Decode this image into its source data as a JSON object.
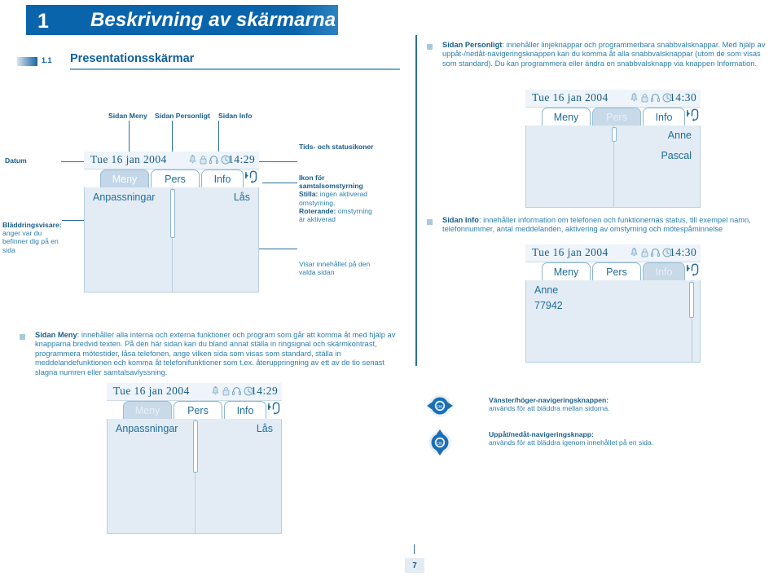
{
  "chapter": {
    "number": "1",
    "title": "Beskrivning av skärmarna"
  },
  "section": {
    "number": "1.1",
    "title": "Presentationsskärmar"
  },
  "paragraphs": {
    "personligt_lead": "Sidan Personligt",
    "personligt_body": ": innehåller linjeknappar och programmerbara snabbvalsknappar. Med hjälp av uppåt-/nedåt-navigeringsknappen kan du komma åt alla snabbvalsknappar (utom de som visas som standard). Du kan programmera eller ändra en snabbvalsknapp via knappen Information.",
    "info_lead": "Sidan Info",
    "info_body": ": innehåller information om telefonen och funktionernas status, till exempel namn, telefonnummer, antal meddelanden, aktivering av omstyrning och mötespåminnelse",
    "meny_lead": "Sidan Meny",
    "meny_body": ": innehåller alla interna och externa funktioner och program som går att komma åt med hjälp av knapparna bredvid texten. På den här sidan kan du bland annat ställa in ringsignal och skärmkontrast, programmera mötestider, låsa telefonen, ange vilken sida som visas som standard, ställa in meddelandefunktionen och komma åt telefonifunktioner som t.ex. återuppringning av ett av de tio senast slagna numren eller samtalsavlyssning."
  },
  "annotations": {
    "sidan_meny": "Sidan Meny",
    "sidan_personligt": "Sidan Personligt",
    "sidan_info": "Sidan Info",
    "datum": "Datum",
    "blad_bold": "Bläddringsvisare:",
    "blad_rest": " anger var du befinner dig på en sida",
    "tids": "Tids- och statusikoner",
    "ikon_title": "Ikon för samtalsomstyrning",
    "ikon_stilla_bold": "Stilla:",
    "ikon_stilla_rest": " ingen aktiverad omstyrning.",
    "ikon_rot_bold": "Roterande:",
    "ikon_rot_rest": " omstyrning är aktiverad",
    "visar": "Visar innehållet på den valda sidan"
  },
  "screens": {
    "main": {
      "date": "Tue 16 jan 2004",
      "time": "14:29",
      "tabs": [
        {
          "label": "Meny",
          "selected": true
        },
        {
          "label": "Pers",
          "selected": false
        },
        {
          "label": "Info",
          "selected": false
        }
      ],
      "left_item": "Anpassningar",
      "right_item": "Lås"
    },
    "pers": {
      "date": "Tue 16 jan 2004",
      "time": "14:30",
      "tabs": [
        {
          "label": "Meny",
          "selected": false
        },
        {
          "label": "Pers",
          "selected": true
        },
        {
          "label": "Info",
          "selected": false
        }
      ],
      "right_items": [
        "Anne",
        "Pascal"
      ]
    },
    "info": {
      "date": "Tue 16 jan 2004",
      "time": "14:30",
      "tabs": [
        {
          "label": "Meny",
          "selected": false
        },
        {
          "label": "Pers",
          "selected": false
        },
        {
          "label": "Info",
          "selected": true
        }
      ],
      "left_items": [
        "Anne",
        "77942"
      ]
    },
    "bottom": {
      "date": "Tue 16 jan 2004",
      "time": "14:29",
      "tabs": [
        {
          "label": "Meny",
          "selected": true
        },
        {
          "label": "Pers",
          "selected": false
        },
        {
          "label": "Info",
          "selected": false
        }
      ],
      "left_item": "Anpassningar",
      "right_item": "Lås"
    }
  },
  "navkeys": {
    "ok_label": "OK",
    "left_right_bold": "Vänster/höger-navigeringsknappen:",
    "left_right_rest": " används för att bläddra mellan sidorna.",
    "up_down_bold": "Uppåt/nedåt-navigeringsknapp:",
    "up_down_rest": " används för att bläddra igenom innehållet på en sida."
  },
  "footer": {
    "page_number": "7"
  },
  "colors": {
    "brand_blue": "#0a64ab",
    "text_blue": "#2d7fae",
    "heading_blue": "#1a5d88",
    "screen_fill": "#e3ecf4",
    "statusbar_fill": "#eef4f9",
    "tab_selected": "#c3d7e8"
  }
}
